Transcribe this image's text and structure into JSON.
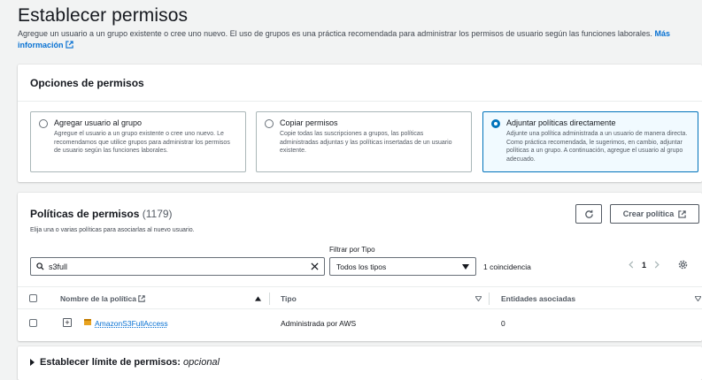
{
  "page": {
    "title": "Establecer permisos",
    "description": "Agregue un usuario a un grupo existente o cree uno nuevo. El uso de grupos es una práctica recomendada para administrar los permisos de usuario según las funciones laborales.",
    "more_info_link": "Más información"
  },
  "permission_options": {
    "title": "Opciones de permisos",
    "options": [
      {
        "label": "Agregar usuario al grupo",
        "description": "Agregue el usuario a un grupo existente o cree uno nuevo. Le recomendamos que utilice grupos para administrar los permisos de usuario según las funciones laborales.",
        "selected": false
      },
      {
        "label": "Copiar permisos",
        "description": "Copie todas las suscripciones a grupos, las políticas administradas adjuntas y las políticas insertadas de un usuario existente.",
        "selected": false
      },
      {
        "label": "Adjuntar políticas directamente",
        "description": "Adjunte una política administrada a un usuario de manera directa. Como práctica recomendada, le sugerimos, en cambio, adjuntar políticas a un grupo. A continuación, agregue el usuario al grupo adecuado.",
        "selected": true
      }
    ]
  },
  "policies": {
    "title": "Políticas de permisos",
    "count": "(1179)",
    "description": "Elija una o varias políticas para asociarlas al nuevo usuario.",
    "create_button": "Crear política",
    "filter_label": "Filtrar por Tipo",
    "search_value": "s3full",
    "type_select_value": "Todos los tipos",
    "match_count": "1 coincidencia",
    "page_number": "1",
    "columns": {
      "name": "Nombre de la política",
      "type": "Tipo",
      "entities": "Entidades asociadas"
    },
    "rows": [
      {
        "name": "AmazonS3FullAccess",
        "type": "Administrada por AWS",
        "entities": "0"
      }
    ]
  },
  "boundary": {
    "title": "Establecer límite de permisos:",
    "suffix": "opcional"
  },
  "colors": {
    "accent": "#0073bb",
    "link": "#0972d3",
    "text": "#16191f"
  }
}
